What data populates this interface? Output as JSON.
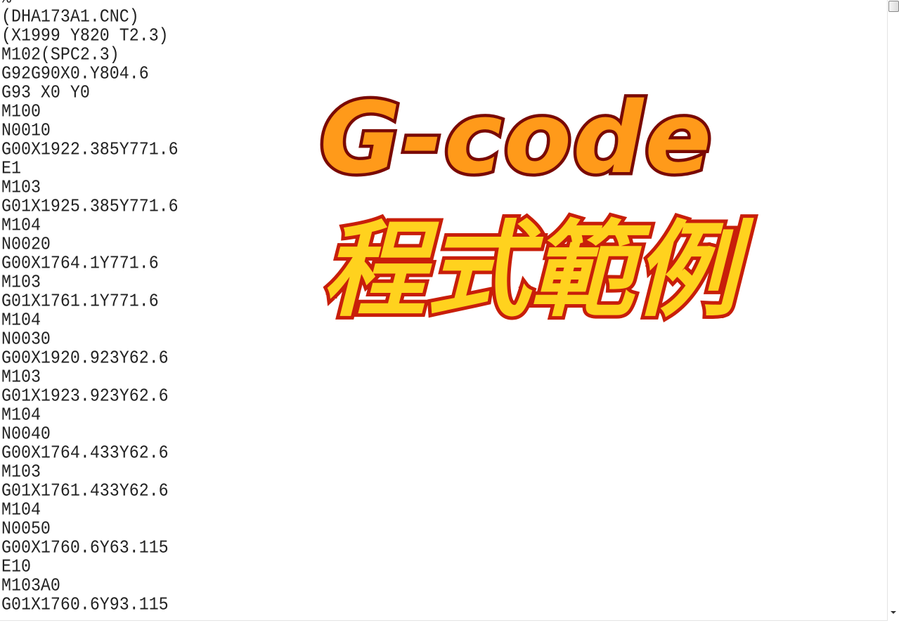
{
  "editor": {
    "lines": [
      "%",
      "(DHA173A1.CNC)",
      "(X1999 Y820 T2.3)",
      "M102(SPC2.3)",
      "G92G90X0.Y804.6",
      "G93 X0 Y0",
      "M100",
      "N0010",
      "G00X1922.385Y771.6",
      "E1",
      "M103",
      "G01X1925.385Y771.6",
      "M104",
      "N0020",
      "G00X1764.1Y771.6",
      "M103",
      "G01X1761.1Y771.6",
      "M104",
      "N0030",
      "G00X1920.923Y62.6",
      "M103",
      "G01X1923.923Y62.6",
      "M104",
      "N0040",
      "G00X1764.433Y62.6",
      "M103",
      "G01X1761.433Y62.6",
      "M104",
      "N0050",
      "G00X1760.6Y63.115",
      "E10",
      "M103A0",
      "G01X1760.6Y93.115"
    ]
  },
  "overlay": {
    "title": "G-code",
    "subtitle": "程式範例",
    "title_color": "#ff9a1a",
    "subtitle_color": "#ffd21e",
    "outline_color": "#7a0a05"
  }
}
